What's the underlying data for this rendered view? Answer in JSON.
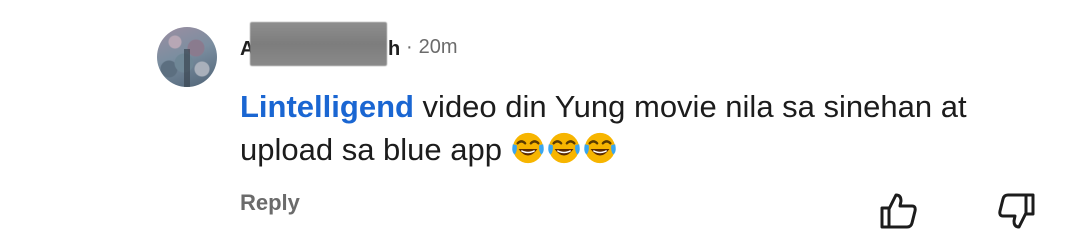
{
  "comment": {
    "author_first": "A",
    "author_last": "h",
    "separator": "·",
    "timestamp": "20m",
    "mention": "Lintelligend",
    "text_part1": " video din Yung movie nila sa sinehan at",
    "text_part2": "upload sa blue app ",
    "emojis": [
      "face-with-tears-of-joy-icon",
      "face-with-tears-of-joy-icon",
      "face-with-tears-of-joy-icon"
    ],
    "reply_label": "Reply",
    "colors": {
      "mention": "#1a66d2",
      "secondary_text": "#6b6b6b",
      "body_text": "#1c1c1c"
    },
    "icons": {
      "like": "thumbs-up-icon",
      "dislike": "thumbs-down-icon"
    }
  }
}
